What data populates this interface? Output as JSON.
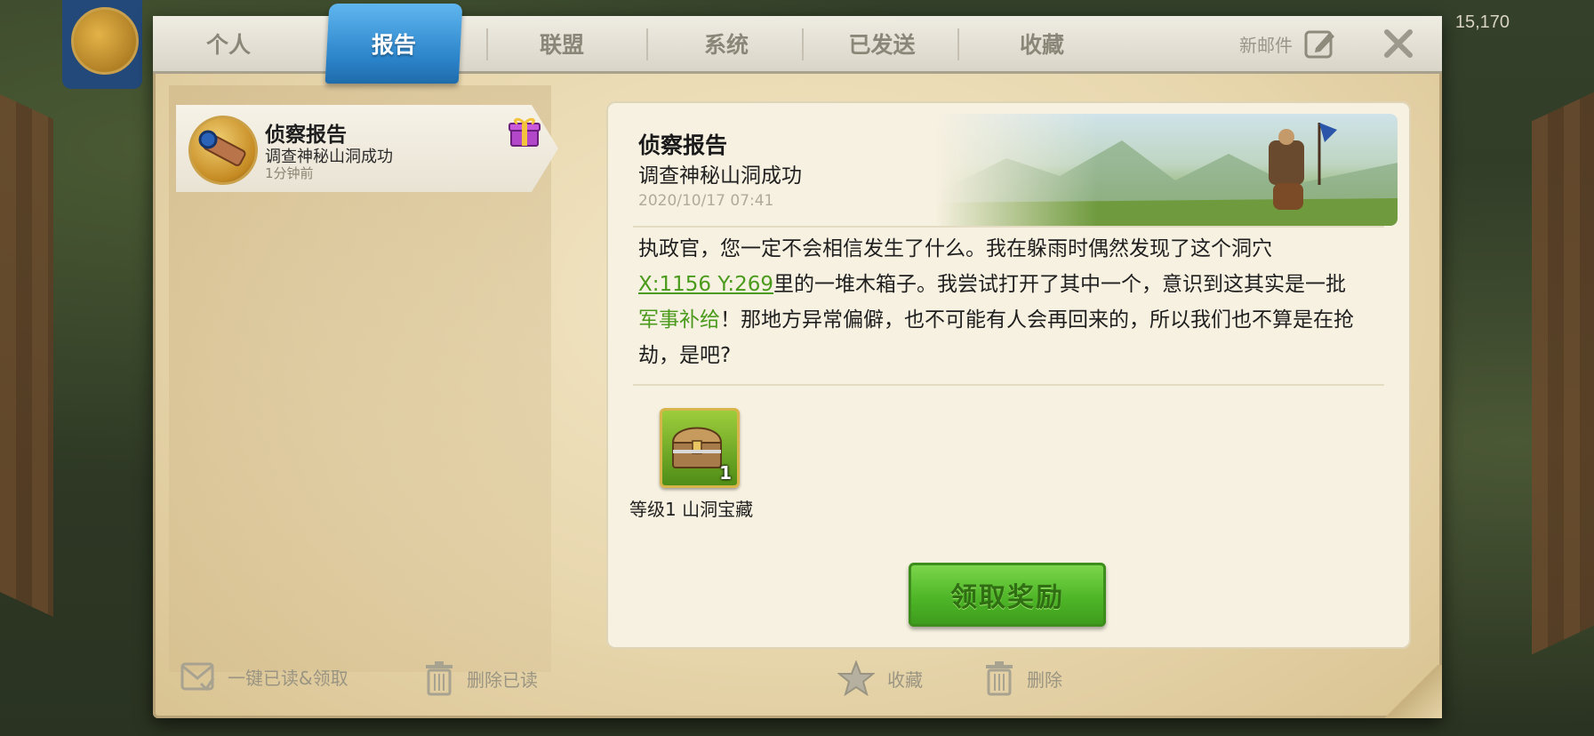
{
  "hud": {
    "power_value": "15,170"
  },
  "tabs": [
    {
      "label": "个人"
    },
    {
      "label": "报告"
    },
    {
      "label": "联盟"
    },
    {
      "label": "系统"
    },
    {
      "label": "已发送"
    },
    {
      "label": "收藏"
    }
  ],
  "active_tab": "报告",
  "header": {
    "new_mail_label": "新邮件"
  },
  "mail_list": {
    "items": [
      {
        "title": "侦察报告",
        "subtitle": "调查神秘山洞成功",
        "time": "1分钟前",
        "icon": "spyglass-icon",
        "has_gift": true
      }
    ]
  },
  "detail": {
    "title": "侦察报告",
    "subtitle": "调查神秘山洞成功",
    "timestamp": "2020/10/17 07:41",
    "body": {
      "part1": "执政官，您一定不会相信发生了什么。我在躲雨时偶然发现了这个洞穴",
      "coords": "X:1156 Y:269",
      "part2": "里的一堆木箱子。我尝试打开了其中一个，意识到这其实是一批",
      "highlight": "军事补给",
      "part3": "！那地方异常偏僻，也不可能有人会再回来的，所以我们也不算是在抢劫，是吧?"
    },
    "reward": {
      "label": "等级1 山洞宝藏",
      "count": "1",
      "icon": "treasure-chest-icon"
    },
    "claim_button": "领取奖励"
  },
  "footer": {
    "read_all_claim": "一键已读&领取",
    "delete_read": "删除已读",
    "favorite": "收藏",
    "delete": "删除"
  },
  "colors": {
    "tab_active": "#2b83c9",
    "link_green": "#4a9a1c",
    "claim_button": "#4fb628",
    "parchment": "#e8d7ae"
  }
}
